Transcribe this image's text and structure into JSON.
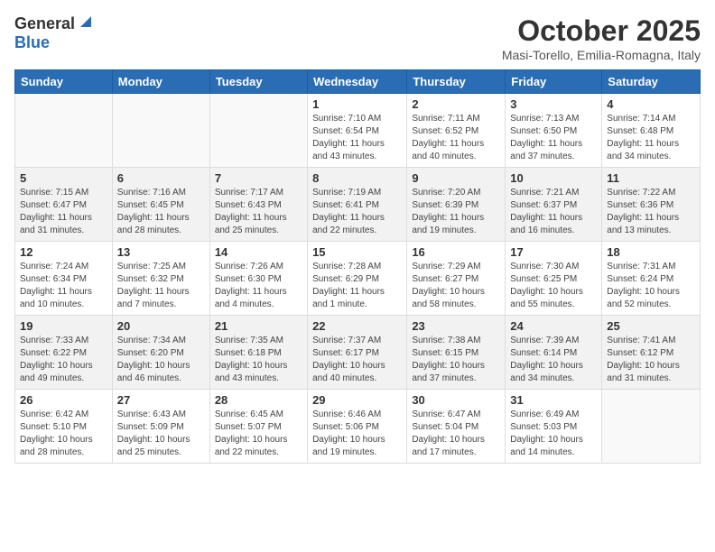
{
  "header": {
    "logo_general": "General",
    "logo_blue": "Blue",
    "month_year": "October 2025",
    "location": "Masi-Torello, Emilia-Romagna, Italy"
  },
  "weekdays": [
    "Sunday",
    "Monday",
    "Tuesday",
    "Wednesday",
    "Thursday",
    "Friday",
    "Saturday"
  ],
  "weeks": [
    [
      {
        "day": "",
        "info": ""
      },
      {
        "day": "",
        "info": ""
      },
      {
        "day": "",
        "info": ""
      },
      {
        "day": "1",
        "info": "Sunrise: 7:10 AM\nSunset: 6:54 PM\nDaylight: 11 hours and 43 minutes."
      },
      {
        "day": "2",
        "info": "Sunrise: 7:11 AM\nSunset: 6:52 PM\nDaylight: 11 hours and 40 minutes."
      },
      {
        "day": "3",
        "info": "Sunrise: 7:13 AM\nSunset: 6:50 PM\nDaylight: 11 hours and 37 minutes."
      },
      {
        "day": "4",
        "info": "Sunrise: 7:14 AM\nSunset: 6:48 PM\nDaylight: 11 hours and 34 minutes."
      }
    ],
    [
      {
        "day": "5",
        "info": "Sunrise: 7:15 AM\nSunset: 6:47 PM\nDaylight: 11 hours and 31 minutes."
      },
      {
        "day": "6",
        "info": "Sunrise: 7:16 AM\nSunset: 6:45 PM\nDaylight: 11 hours and 28 minutes."
      },
      {
        "day": "7",
        "info": "Sunrise: 7:17 AM\nSunset: 6:43 PM\nDaylight: 11 hours and 25 minutes."
      },
      {
        "day": "8",
        "info": "Sunrise: 7:19 AM\nSunset: 6:41 PM\nDaylight: 11 hours and 22 minutes."
      },
      {
        "day": "9",
        "info": "Sunrise: 7:20 AM\nSunset: 6:39 PM\nDaylight: 11 hours and 19 minutes."
      },
      {
        "day": "10",
        "info": "Sunrise: 7:21 AM\nSunset: 6:37 PM\nDaylight: 11 hours and 16 minutes."
      },
      {
        "day": "11",
        "info": "Sunrise: 7:22 AM\nSunset: 6:36 PM\nDaylight: 11 hours and 13 minutes."
      }
    ],
    [
      {
        "day": "12",
        "info": "Sunrise: 7:24 AM\nSunset: 6:34 PM\nDaylight: 11 hours and 10 minutes."
      },
      {
        "day": "13",
        "info": "Sunrise: 7:25 AM\nSunset: 6:32 PM\nDaylight: 11 hours and 7 minutes."
      },
      {
        "day": "14",
        "info": "Sunrise: 7:26 AM\nSunset: 6:30 PM\nDaylight: 11 hours and 4 minutes."
      },
      {
        "day": "15",
        "info": "Sunrise: 7:28 AM\nSunset: 6:29 PM\nDaylight: 11 hours and 1 minute."
      },
      {
        "day": "16",
        "info": "Sunrise: 7:29 AM\nSunset: 6:27 PM\nDaylight: 10 hours and 58 minutes."
      },
      {
        "day": "17",
        "info": "Sunrise: 7:30 AM\nSunset: 6:25 PM\nDaylight: 10 hours and 55 minutes."
      },
      {
        "day": "18",
        "info": "Sunrise: 7:31 AM\nSunset: 6:24 PM\nDaylight: 10 hours and 52 minutes."
      }
    ],
    [
      {
        "day": "19",
        "info": "Sunrise: 7:33 AM\nSunset: 6:22 PM\nDaylight: 10 hours and 49 minutes."
      },
      {
        "day": "20",
        "info": "Sunrise: 7:34 AM\nSunset: 6:20 PM\nDaylight: 10 hours and 46 minutes."
      },
      {
        "day": "21",
        "info": "Sunrise: 7:35 AM\nSunset: 6:18 PM\nDaylight: 10 hours and 43 minutes."
      },
      {
        "day": "22",
        "info": "Sunrise: 7:37 AM\nSunset: 6:17 PM\nDaylight: 10 hours and 40 minutes."
      },
      {
        "day": "23",
        "info": "Sunrise: 7:38 AM\nSunset: 6:15 PM\nDaylight: 10 hours and 37 minutes."
      },
      {
        "day": "24",
        "info": "Sunrise: 7:39 AM\nSunset: 6:14 PM\nDaylight: 10 hours and 34 minutes."
      },
      {
        "day": "25",
        "info": "Sunrise: 7:41 AM\nSunset: 6:12 PM\nDaylight: 10 hours and 31 minutes."
      }
    ],
    [
      {
        "day": "26",
        "info": "Sunrise: 6:42 AM\nSunset: 5:10 PM\nDaylight: 10 hours and 28 minutes."
      },
      {
        "day": "27",
        "info": "Sunrise: 6:43 AM\nSunset: 5:09 PM\nDaylight: 10 hours and 25 minutes."
      },
      {
        "day": "28",
        "info": "Sunrise: 6:45 AM\nSunset: 5:07 PM\nDaylight: 10 hours and 22 minutes."
      },
      {
        "day": "29",
        "info": "Sunrise: 6:46 AM\nSunset: 5:06 PM\nDaylight: 10 hours and 19 minutes."
      },
      {
        "day": "30",
        "info": "Sunrise: 6:47 AM\nSunset: 5:04 PM\nDaylight: 10 hours and 17 minutes."
      },
      {
        "day": "31",
        "info": "Sunrise: 6:49 AM\nSunset: 5:03 PM\nDaylight: 10 hours and 14 minutes."
      },
      {
        "day": "",
        "info": ""
      }
    ]
  ]
}
